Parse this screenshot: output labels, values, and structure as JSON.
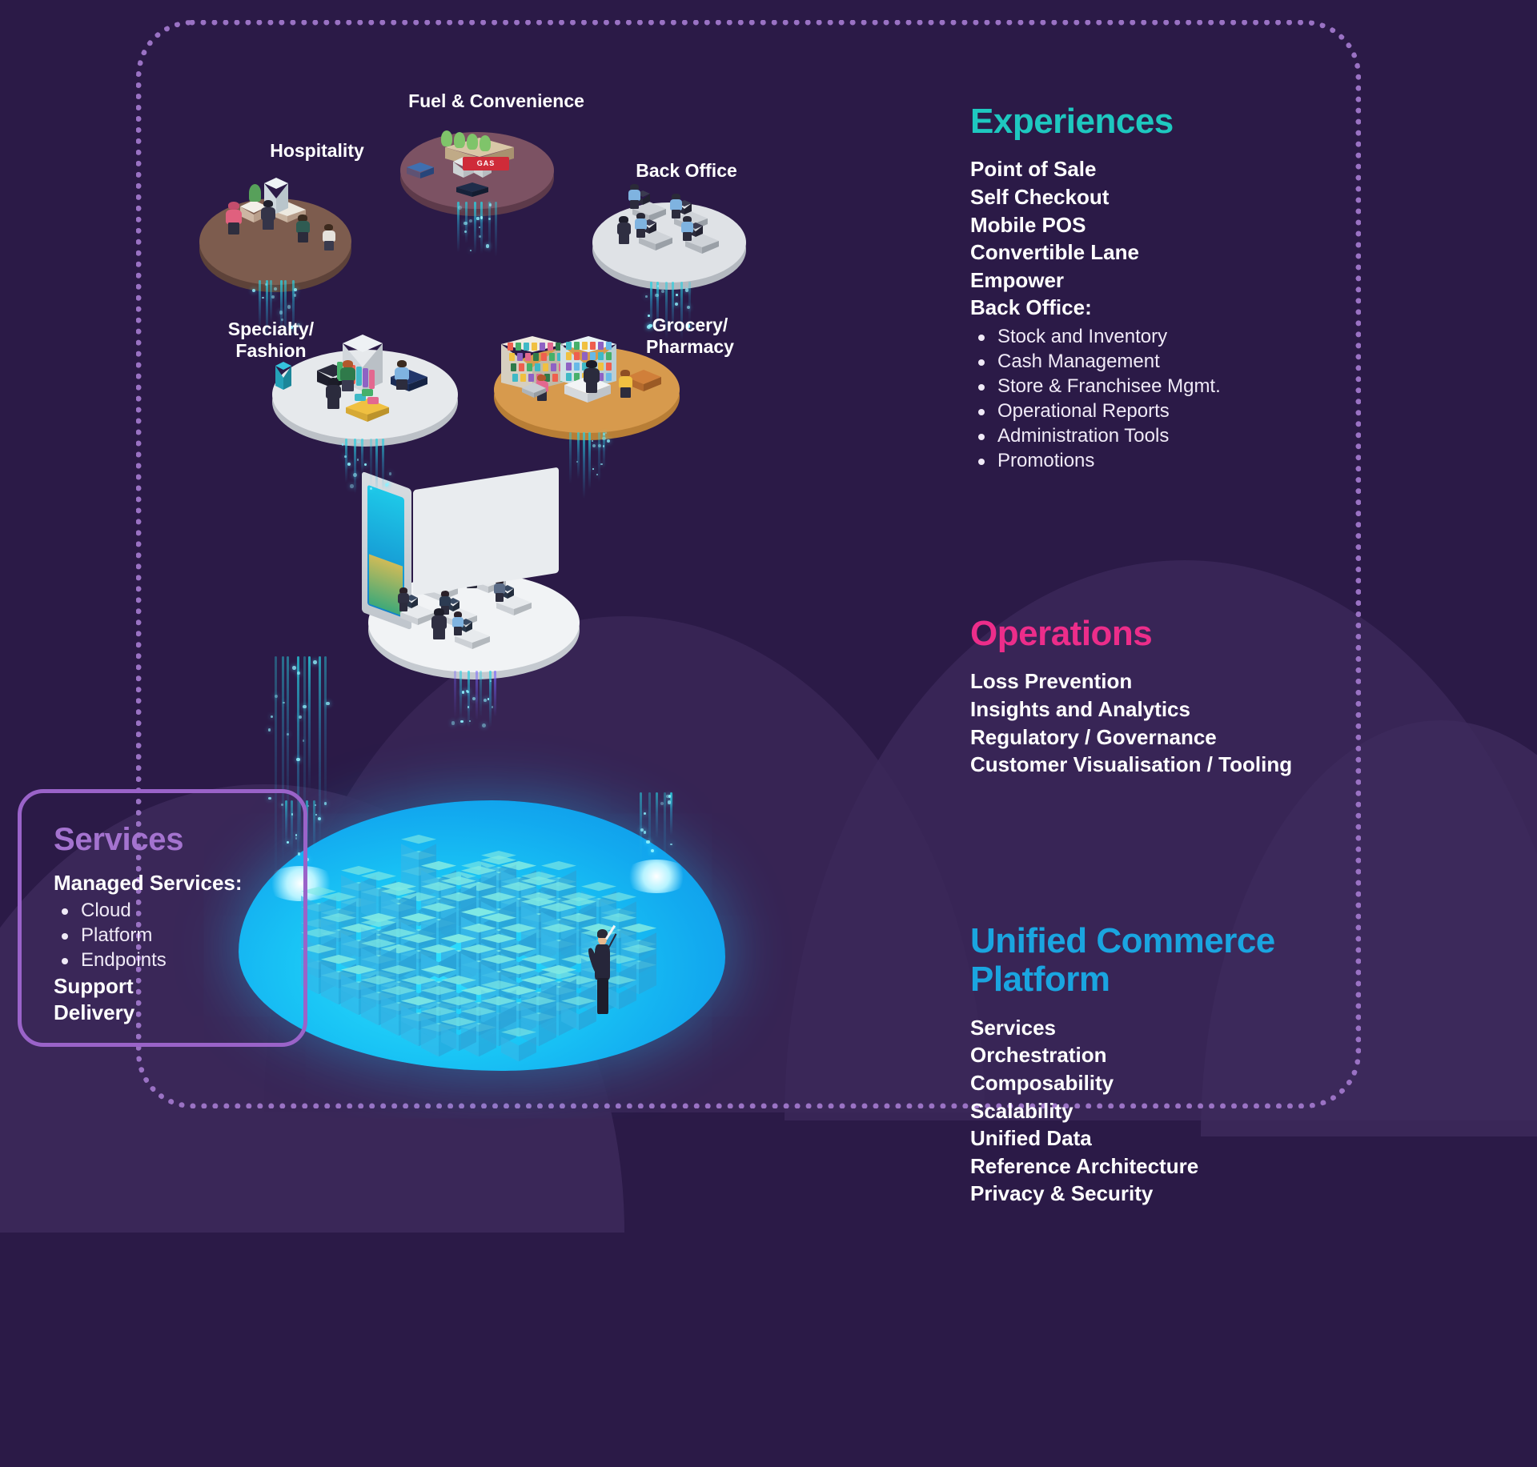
{
  "theme": {
    "background": "#2b1a47",
    "frame_border": "#9a72c4",
    "experiences_accent": "#1ec8c0",
    "operations_accent": "#ec2d8a",
    "platform_accent": "#1aa5e0",
    "services_accent": "#a473cf"
  },
  "scene_labels": [
    {
      "id": "hospitality",
      "text": "Hospitality"
    },
    {
      "id": "fuel-convenience",
      "text": "Fuel & Convenience"
    },
    {
      "id": "back-office",
      "text": "Back Office"
    },
    {
      "id": "specialty-fashion",
      "text": "Specialty/\nFashion"
    },
    {
      "id": "grocery-pharmacy",
      "text": "Grocery/\nPharmacy"
    }
  ],
  "experiences": {
    "title": "Experiences",
    "items": [
      "Point of Sale",
      "Self Checkout",
      "Mobile POS",
      "Convertible Lane",
      "Empower",
      "Back Office:"
    ],
    "back_office_bullets": [
      "Stock and Inventory",
      "Cash Management",
      "Store & Franchisee Mgmt.",
      "Operational Reports",
      "Administration Tools",
      "Promotions"
    ]
  },
  "operations": {
    "title": "Operations",
    "items": [
      "Loss Prevention",
      "Insights and Analytics",
      "Regulatory / Governance",
      "Customer Visualisation / Tooling"
    ]
  },
  "platform": {
    "title": "Unified Commerce\nPlatform",
    "items": [
      "Services",
      "Orchestration",
      "Composability",
      "Scalability",
      "Unified Data",
      "Reference Architecture",
      "Privacy & Security"
    ]
  },
  "services": {
    "title": "Services",
    "subtitle": "Managed Services:",
    "bullets": [
      "Cloud",
      "Platform",
      "Endpoints"
    ],
    "items": [
      "Support",
      "Delivery"
    ]
  }
}
